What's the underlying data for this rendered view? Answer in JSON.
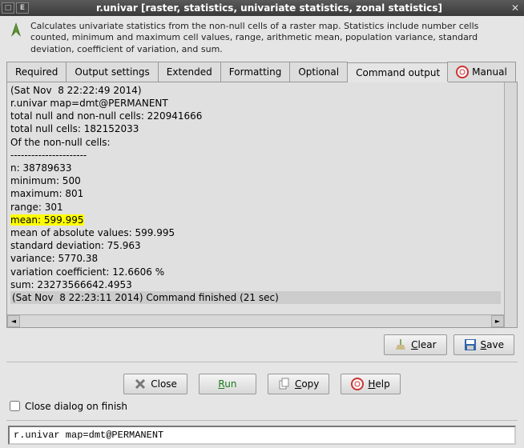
{
  "titlebar": {
    "title": "r.univar [raster, statistics, univariate statistics, zonal statistics]"
  },
  "description": "Calculates univariate statistics from the non-null cells of a raster map. Statistics include number cells counted, minimum and maximum cell values, range, arithmetic mean, population variance, standard deviation, coefficient of variation, and sum.",
  "tabs": {
    "required": "Required",
    "output_settings": "Output settings",
    "extended": "Extended",
    "formatting": "Formatting",
    "optional": "Optional",
    "command_output": "Command output",
    "manual": "Manual"
  },
  "output": {
    "line0": "(Sat Nov  8 22:22:49 2014)",
    "line1": "r.univar map=dmt@PERMANENT",
    "line2": "total null and non-null cells: 220941666",
    "line3": "total null cells: 182152033",
    "line4": "Of the non-null cells:",
    "line5": "----------------------",
    "line6": "n: 38789633",
    "line7": "minimum: 500",
    "line8": "maximum: 801",
    "line9": "range: 301",
    "line10_hl": "mean: 599.995",
    "line11": "mean of absolute values: 599.995",
    "line12": "standard deviation: 75.963",
    "line13": "variance: 5770.38",
    "line14": "variation coefficient: 12.6606 %",
    "line15": "sum: 23273566642.4953",
    "line16": "(Sat Nov  8 22:23:11 2014) Command finished (21 sec)"
  },
  "buttons": {
    "clear": "Clear",
    "save": "Save",
    "close": "Close",
    "run": "Run",
    "copy": "Copy",
    "help": "Help"
  },
  "checkbox": {
    "label": "Close dialog on finish"
  },
  "command": {
    "value": "r.univar map=dmt@PERMANENT"
  }
}
